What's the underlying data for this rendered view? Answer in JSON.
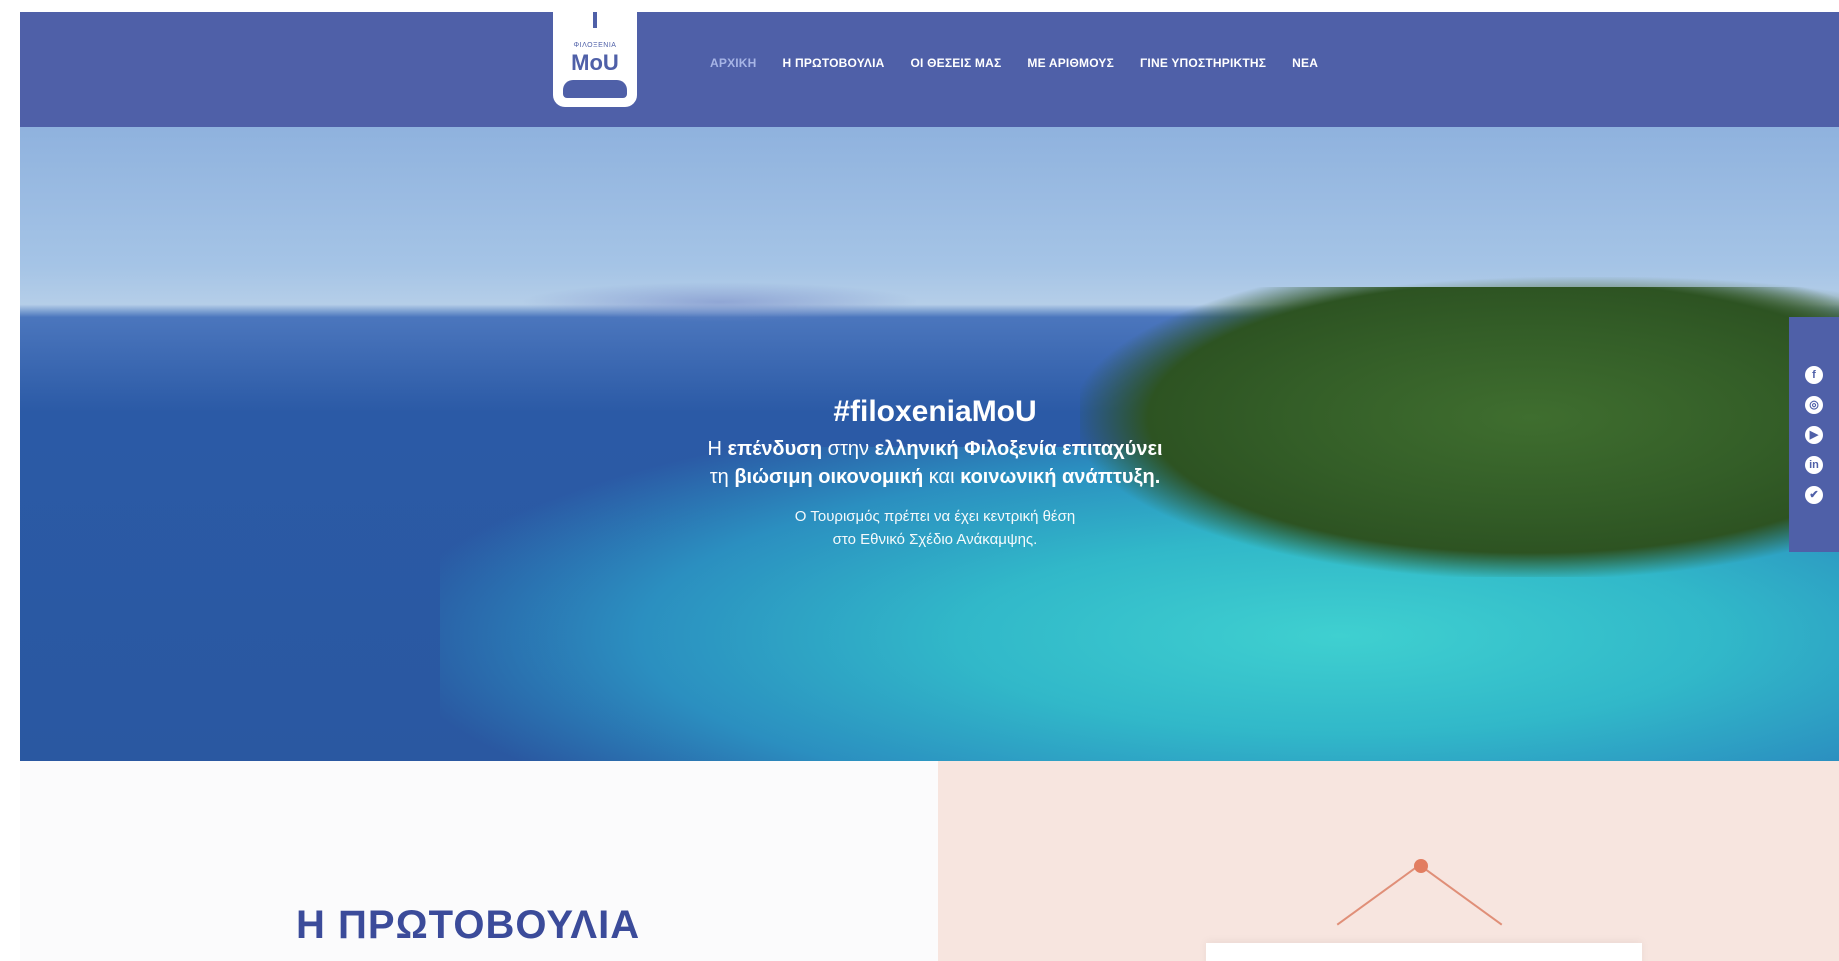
{
  "logo": {
    "small_text": "ΦΙΛΟΞΕΝΙΑ",
    "word": "MoU"
  },
  "nav": [
    {
      "label": "ΑΡΧΙΚΗ",
      "active": true
    },
    {
      "label": "Η ΠΡΩΤΟΒΟΥΛΙΑ",
      "active": false
    },
    {
      "label": "ΟΙ ΘΕΣΕΙΣ ΜΑΣ",
      "active": false
    },
    {
      "label": "ΜΕ ΑΡΙΘΜΟΥΣ",
      "active": false
    },
    {
      "label": "ΓΙΝΕ ΥΠΟΣΤΗΡΙΚΤΗΣ",
      "active": false
    },
    {
      "label": "ΝΕΑ",
      "active": false
    }
  ],
  "hero": {
    "hashtag": "#filoxeniaMoU",
    "lead1_a": "Η ",
    "lead1_b": "επένδυση",
    "lead1_c": " στην ",
    "lead1_d": "ελληνική Φιλοξενία επιταχύνει",
    "lead2_a": "τη ",
    "lead2_b": "βιώσιμη οικονομική",
    "lead2_c": " και ",
    "lead2_d": "κοινωνική ανάπτυξη.",
    "sub1": "Ο Τουρισμός πρέπει να έχει κεντρική θέση",
    "sub2": "στο Εθνικό Σχέδιο Ανάκαμψης."
  },
  "social": [
    {
      "icon": "facebook-icon",
      "glyph": "f"
    },
    {
      "icon": "instagram-icon",
      "glyph": "◎"
    },
    {
      "icon": "youtube-icon",
      "glyph": "▶"
    },
    {
      "icon": "linkedin-icon",
      "glyph": "in"
    },
    {
      "icon": "twitter-icon",
      "glyph": "✔"
    }
  ],
  "initiative": {
    "title": "Η ΠΡΩΤΟΒΟΥΛΙΑ"
  },
  "colors": {
    "brand": "#4f60a8",
    "accent": "#e27d60",
    "peach": "#f7e5df"
  }
}
